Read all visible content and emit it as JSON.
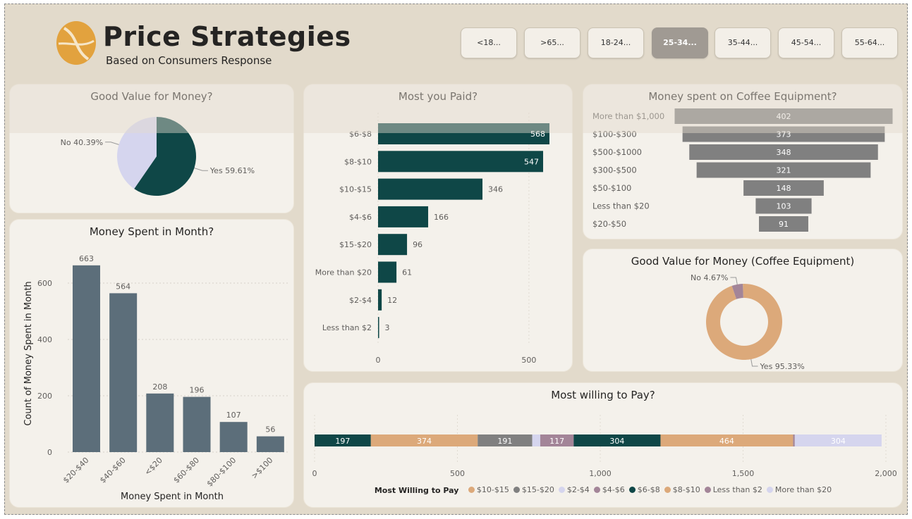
{
  "header": {
    "title": "Price Strategies",
    "subtitle": "Based on Consumers Response"
  },
  "colors": {
    "dark_teal": "#0f4747",
    "lavender": "#d5d5ee",
    "slate": "#5c6e7a",
    "gray": "#808080",
    "tan": "#dca97a",
    "mauve": "#a38598",
    "background": "#e2dacb",
    "card": "#f4f1eb",
    "logo": "#e2a23e"
  },
  "slicers": [
    {
      "label": "<18...",
      "active": false
    },
    {
      "label": ">65...",
      "active": false
    },
    {
      "label": "18-24...",
      "active": false
    },
    {
      "label": "25-34...",
      "active": true
    },
    {
      "label": "35-44...",
      "active": false
    },
    {
      "label": "45-54...",
      "active": false
    },
    {
      "label": "55-64...",
      "active": false
    }
  ],
  "chart_data": [
    {
      "id": "good_value",
      "type": "pie",
      "title": "Good Value for Money?",
      "slices": [
        {
          "label": "Yes",
          "value": 59.61,
          "display": "Yes 59.61%",
          "color": "#0f4747"
        },
        {
          "label": "No",
          "value": 40.39,
          "display": "No 40.39%",
          "color": "#d5d5ee"
        }
      ]
    },
    {
      "id": "money_spent_month",
      "type": "bar",
      "title": "Money Spent in Month?",
      "xlabel": "Money Spent in Month",
      "ylabel": "Count of Money Spent in Month",
      "categories": [
        "$20-$40",
        "$40-$60",
        "<$20",
        "$60-$80",
        "$80-$100",
        ">$100"
      ],
      "values": [
        663,
        564,
        208,
        196,
        107,
        56
      ],
      "yticks": [
        0,
        200,
        400,
        600
      ],
      "ylim": [
        0,
        700
      ],
      "grid": true
    },
    {
      "id": "most_paid",
      "type": "bar",
      "orientation": "horizontal",
      "title": "Most you Paid?",
      "categories": [
        "$6-$8",
        "$8-$10",
        "$10-$15",
        "$4-$6",
        "$15-$20",
        "More than $20",
        "$2-$4",
        "Less than $2"
      ],
      "values": [
        568,
        547,
        346,
        166,
        96,
        61,
        12,
        3
      ],
      "xticks": [
        0,
        500
      ],
      "xlim": [
        0,
        568
      ]
    },
    {
      "id": "equipment_spent",
      "type": "bar",
      "orientation": "funnel",
      "title": "Money spent on Coffee Equipment?",
      "categories": [
        "More than $1,000",
        "$100-$300",
        "$500-$1000",
        "$300-$500",
        "$50-$100",
        "Less than $20",
        "$20-$50"
      ],
      "values": [
        402,
        373,
        348,
        321,
        148,
        103,
        91
      ]
    },
    {
      "id": "equipment_value",
      "type": "pie",
      "variant": "donut",
      "title": "Good Value for Money (Coffee Equipment)",
      "slices": [
        {
          "label": "Yes",
          "value": 95.33,
          "display": "Yes 95.33%",
          "color": "#dca97a"
        },
        {
          "label": "No",
          "value": 4.67,
          "display": "No 4.67%",
          "color": "#a38598"
        }
      ]
    },
    {
      "id": "willing_to_pay",
      "type": "bar",
      "orientation": "stacked-horizontal",
      "title": "Most willing to Pay?",
      "legend_title": "Most Willing to Pay",
      "series": [
        {
          "name": "$6-$8",
          "value": 197,
          "color": "#0f4747",
          "label": "197"
        },
        {
          "name": "$10-$15",
          "value": 374,
          "color": "#dca97a",
          "label": "374"
        },
        {
          "name": "$15-$20",
          "value": 191,
          "color": "#808080",
          "label": "191"
        },
        {
          "name": "$2-$4",
          "value": 28,
          "color": "#d5d5ee",
          "label": ""
        },
        {
          "name": "$4-$6",
          "value": 117,
          "color": "#a38598",
          "label": "117"
        },
        {
          "name": "$6-$8",
          "value": 304,
          "color": "#0f4747",
          "label": "304"
        },
        {
          "name": "$8-$10",
          "value": 464,
          "color": "#dca97a",
          "label": "464"
        },
        {
          "name": "Less than $2",
          "value": 6,
          "color": "#a38598",
          "label": ""
        },
        {
          "name": "More than $20",
          "value": 304,
          "color": "#d5d5ee",
          "label": "304"
        }
      ],
      "legend": [
        {
          "name": "$10-$15",
          "color": "#dca97a"
        },
        {
          "name": "$15-$20",
          "color": "#808080"
        },
        {
          "name": "$2-$4",
          "color": "#d5d5ee"
        },
        {
          "name": "$4-$6",
          "color": "#a38598"
        },
        {
          "name": "$6-$8",
          "color": "#0f4747"
        },
        {
          "name": "$8-$10",
          "color": "#dca97a"
        },
        {
          "name": "Less than $2",
          "color": "#a38598"
        },
        {
          "name": "More than $20",
          "color": "#d5d5ee"
        }
      ],
      "xticks": [
        0,
        500,
        1000,
        1500,
        2000
      ],
      "xtick_labels": [
        "0",
        "500",
        "1,000",
        "1,500",
        "2,000"
      ],
      "xlim": [
        0,
        2000
      ]
    }
  ]
}
